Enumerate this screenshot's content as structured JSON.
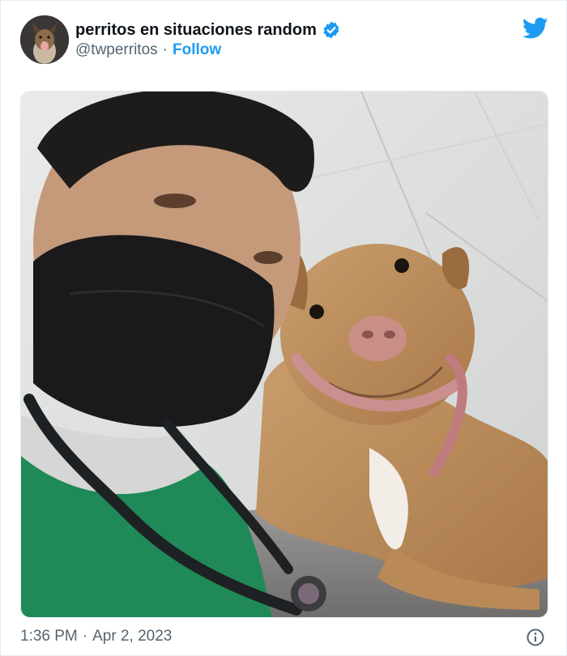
{
  "tweet": {
    "author": {
      "display_name": "perritos en situaciones random",
      "handle": "@twperritos",
      "verified": true,
      "follow_label": "Follow",
      "separator": "·"
    },
    "logo_icon": "twitter-bird-icon",
    "media": {
      "description_icon": "photo"
    },
    "time": "1:36 PM",
    "date": "Apr 2, 2023",
    "info_icon": "info-icon"
  },
  "colors": {
    "accent": "#1d9bf0",
    "text_primary": "#0f1419",
    "text_secondary": "#536471"
  }
}
